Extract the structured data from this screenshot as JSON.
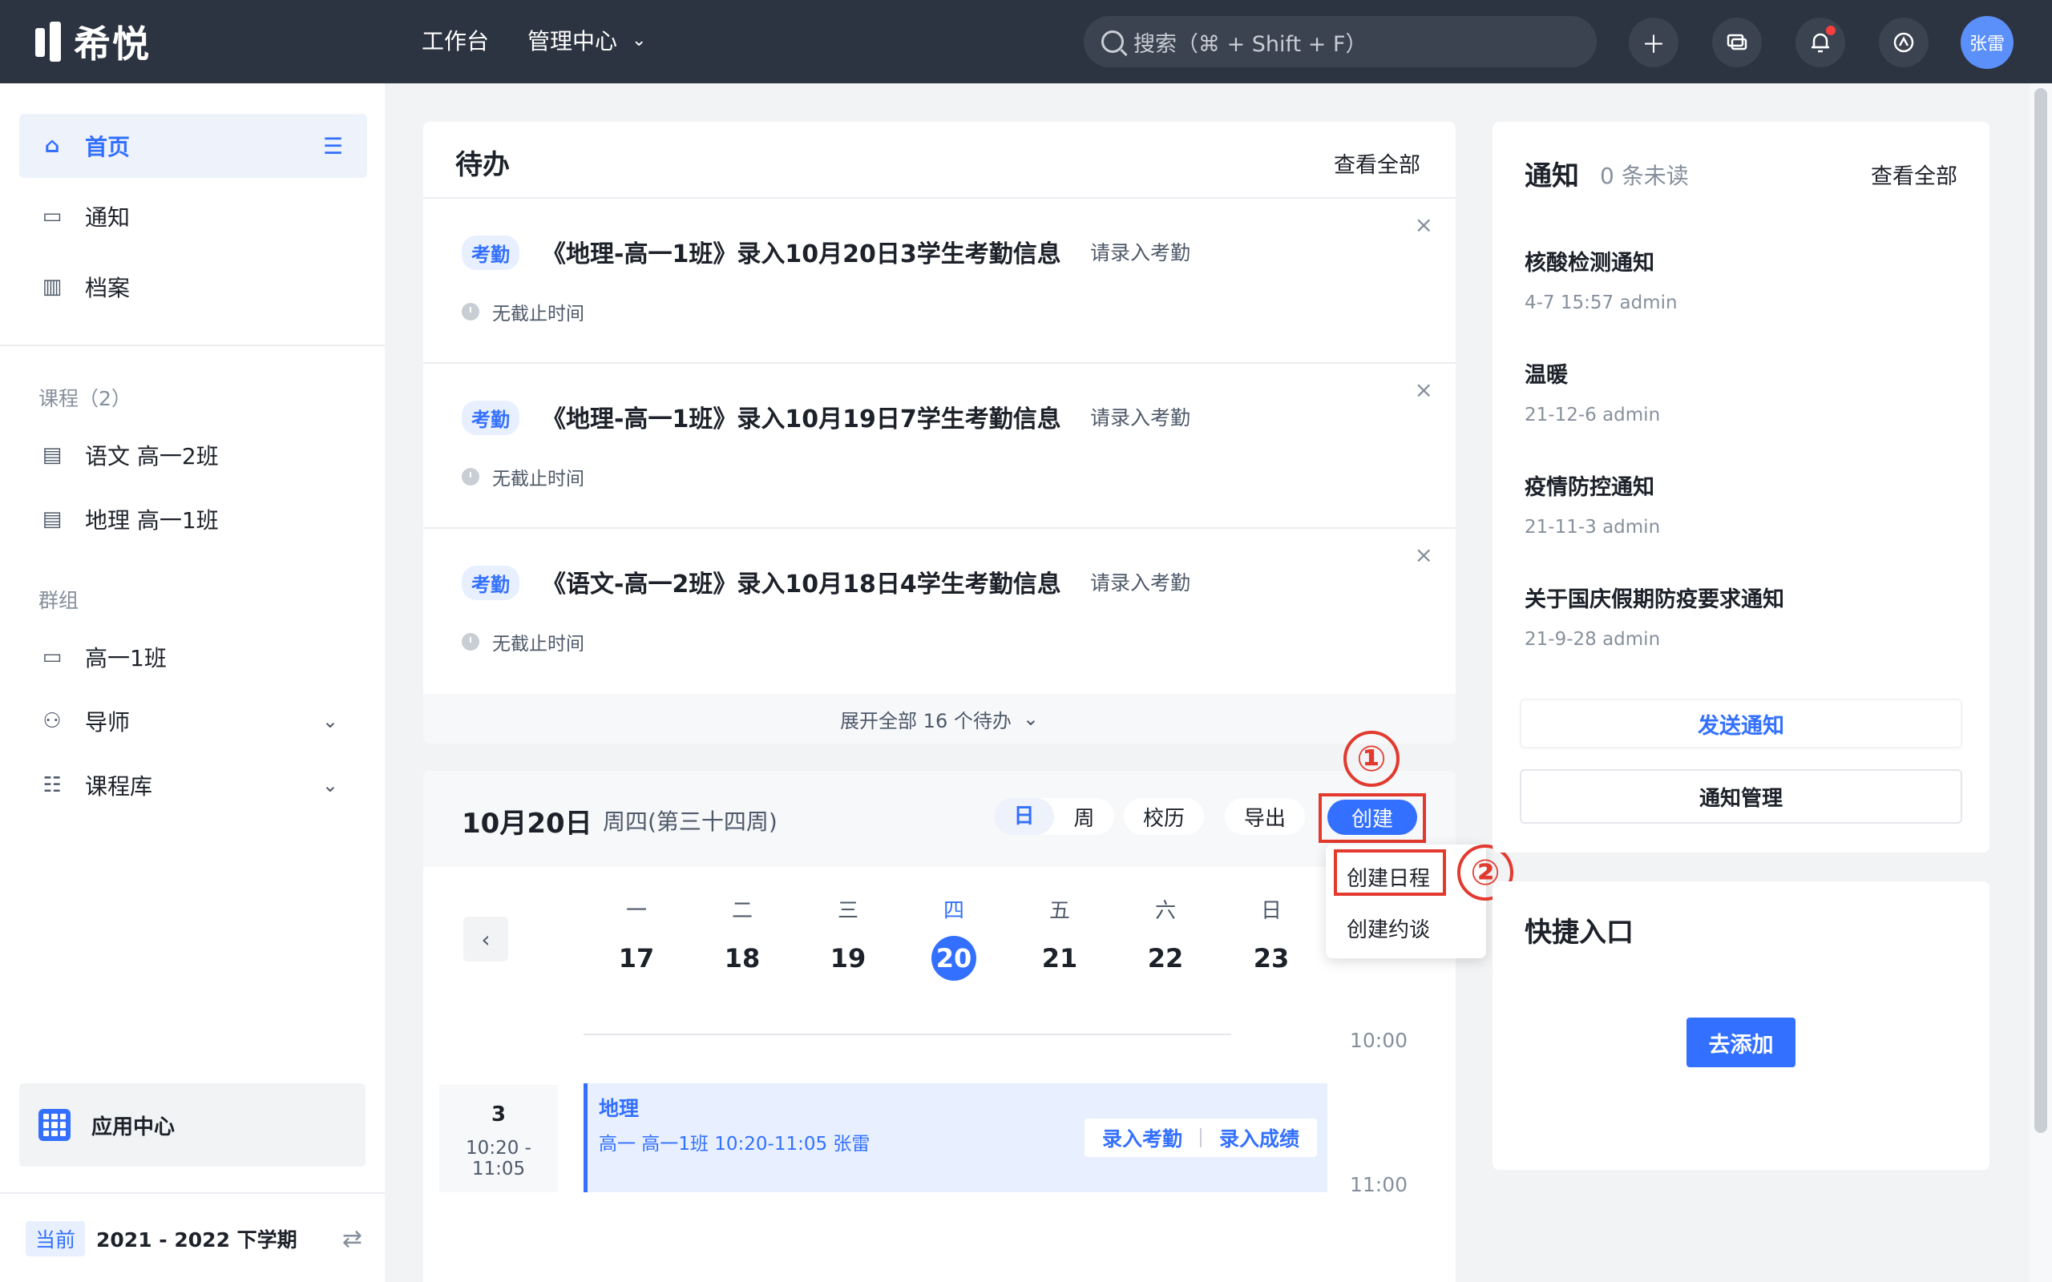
{
  "app": {
    "logo_text": "希悦"
  },
  "topbar": {
    "nav": [
      {
        "label": "工作台"
      },
      {
        "label": "管理中心"
      }
    ],
    "search_placeholder": "搜索（⌘ + Shift + F）",
    "user_name": "张雷"
  },
  "sidebar": {
    "items": [
      {
        "label": "首页"
      },
      {
        "label": "通知"
      },
      {
        "label": "档案"
      }
    ],
    "course_group": "课程（2）",
    "courses": [
      {
        "label": "语文 高一2班"
      },
      {
        "label": "地理 高一1班"
      }
    ],
    "group_title": "群组",
    "groups": [
      {
        "label": "高一1班"
      },
      {
        "label": "导师"
      },
      {
        "label": "课程库"
      }
    ],
    "app_center": "应用中心",
    "term_badge": "当前",
    "term": "2021 - 2022 下学期"
  },
  "todo": {
    "title": "待办",
    "view_all": "查看全部",
    "items": [
      {
        "tag": "考勤",
        "title": "《地理-高一1班》录入10月20日3学生考勤信息",
        "action": "请录入考勤",
        "deadline": "无截止时间"
      },
      {
        "tag": "考勤",
        "title": "《地理-高一1班》录入10月19日7学生考勤信息",
        "action": "请录入考勤",
        "deadline": "无截止时间"
      },
      {
        "tag": "考勤",
        "title": "《语文-高一2班》录入10月18日4学生考勤信息",
        "action": "请录入考勤",
        "deadline": "无截止时间"
      }
    ],
    "expand": "展开全部 16 个待办"
  },
  "calendar": {
    "date": "10月20日",
    "week": "周四(第三十四周)",
    "view_day": "日",
    "view_week": "周",
    "school_calendar": "校历",
    "export": "导出",
    "create": "创建",
    "days": [
      {
        "dw": "一",
        "dn": "17"
      },
      {
        "dw": "二",
        "dn": "18"
      },
      {
        "dw": "三",
        "dn": "19"
      },
      {
        "dw": "四",
        "dn": "20"
      },
      {
        "dw": "五",
        "dn": "21"
      },
      {
        "dw": "六",
        "dn": "22"
      },
      {
        "dw": "日",
        "dn": "23"
      }
    ],
    "time_1000": "10:00",
    "time_1100": "11:00",
    "period_no": "3",
    "period_time": "10:20 - 11:05",
    "event": {
      "title": "地理",
      "detail": "高一  高一1班  10:20-11:05  张雷",
      "action_attendance": "录入考勤",
      "action_score": "录入成绩"
    },
    "dropdown": {
      "schedule": "创建日程",
      "appointment": "创建约谈"
    },
    "step1": "①",
    "step2": "②"
  },
  "notice": {
    "title": "通知",
    "unread": "0 条未读",
    "view_all": "查看全部",
    "items": [
      {
        "title": "核酸检测通知",
        "meta": "4-7 15:57  admin"
      },
      {
        "title": "温暖",
        "meta": "21-12-6  admin"
      },
      {
        "title": "疫情防控通知",
        "meta": "21-11-3  admin"
      },
      {
        "title": "关于国庆假期防疫要求通知",
        "meta": "21-9-28  admin"
      }
    ],
    "send": "发送通知",
    "manage": "通知管理"
  },
  "shortcut": {
    "title": "快捷入口",
    "add": "去添加"
  },
  "colors": {
    "accent": "#3370ff",
    "topbar": "#2d3441",
    "highlight": "#e23a2e"
  }
}
